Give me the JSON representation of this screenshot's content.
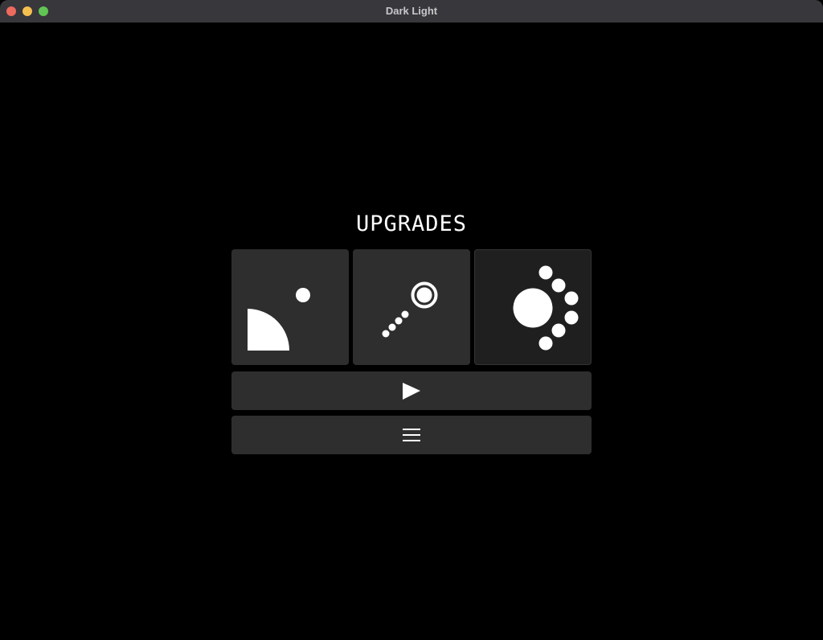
{
  "window": {
    "title": "Dark Light"
  },
  "screen": {
    "heading": "UPGRADES"
  },
  "upgrades": [
    {
      "icon": "quarter-circle-orb-icon",
      "selected": false
    },
    {
      "icon": "trail-ring-icon",
      "selected": false
    },
    {
      "icon": "orbiting-dots-icon",
      "selected": true
    }
  ],
  "buttons": {
    "play": "play-icon",
    "menu": "menu-icon"
  }
}
